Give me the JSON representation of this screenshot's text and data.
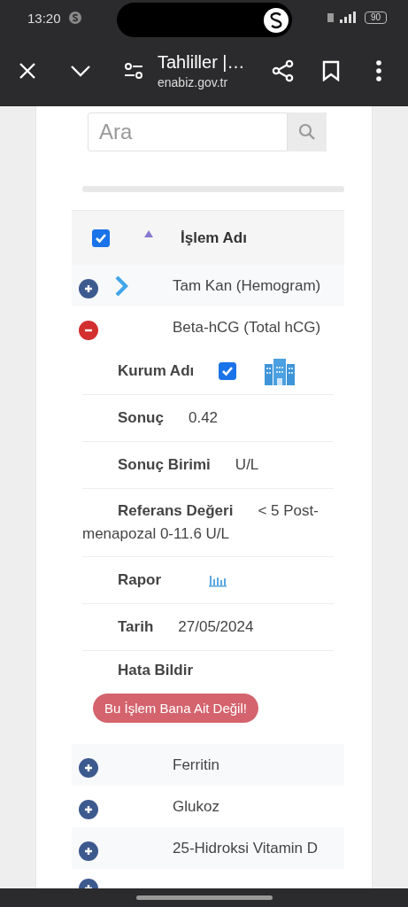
{
  "status_bar": {
    "time": "13:20",
    "battery": "90"
  },
  "browser": {
    "title": "Tahliller |…",
    "url": "enabiz.gov.tr"
  },
  "search": {
    "placeholder": "Ara"
  },
  "table": {
    "header": {
      "checked": true,
      "column": "İşlem Adı"
    },
    "rows": [
      {
        "name": "Tam Kan (Hemogram)",
        "expanded": false,
        "pointer": true
      },
      {
        "name": "Beta-hCG (Total hCG)",
        "expanded": true,
        "pointer": false,
        "details": [
          {
            "kind": "checkbox",
            "label": "Kurum Adı",
            "checked": true
          },
          {
            "kind": "text",
            "label": "Sonuç",
            "value": "0.42"
          },
          {
            "kind": "text",
            "label": "Sonuç Birimi",
            "value": "U/L"
          },
          {
            "kind": "text",
            "label": "Referans Değeri",
            "value": "< 5 Post-menapozal 0-11.6 U/L"
          },
          {
            "kind": "report",
            "label": "Rapor"
          },
          {
            "kind": "text",
            "label": "Tarih",
            "value": "27/05/2024"
          },
          {
            "kind": "button",
            "label": "Hata Bildir",
            "button": "Bu İşlem Bana Ait Değil!"
          }
        ]
      },
      {
        "name": "Ferritin",
        "expanded": false,
        "pointer": false
      },
      {
        "name": "Glukoz",
        "expanded": false,
        "pointer": false
      },
      {
        "name": "25-Hidroksi Vitamin D",
        "expanded": false,
        "pointer": false
      },
      {
        "expanded": false,
        "pointer": false
      }
    ]
  }
}
